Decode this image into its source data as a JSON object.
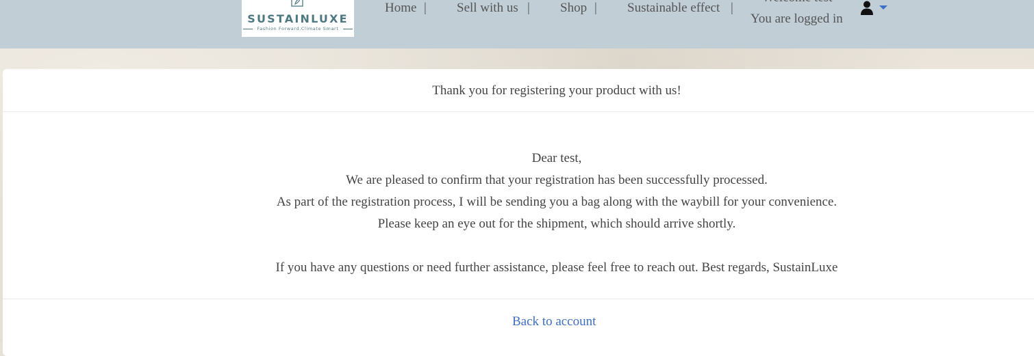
{
  "brand": {
    "name": "SUSTAINLUXE",
    "tagline": "Fashion Forward.Climate Smart",
    "color": "#4d7882"
  },
  "nav": {
    "items": [
      {
        "label": "Home"
      },
      {
        "label": "Sell with us"
      },
      {
        "label": "Shop"
      },
      {
        "label": "Sustainable effect"
      }
    ],
    "separator": "|",
    "welcome": "Welcome test",
    "logged_in": "You are logged in",
    "user_icon": "user-icon",
    "caret_icon": "caret-down-icon",
    "bar_color": "#c1ced6"
  },
  "card": {
    "header": "Thank you for registering your product with us!",
    "greeting": "Dear test,",
    "lines": [
      "We are pleased to confirm that your registration has been successfully processed.",
      "As part of the registration process, I will be sending you a bag along with the waybill for your convenience.",
      "Please keep an eye out for the shipment, which should arrive shortly."
    ],
    "closing": "If you have any questions or need further assistance, please feel free to reach out. Best regards, SustainLuxe",
    "back_link": "Back to account",
    "link_color": "#3d6fc4"
  }
}
